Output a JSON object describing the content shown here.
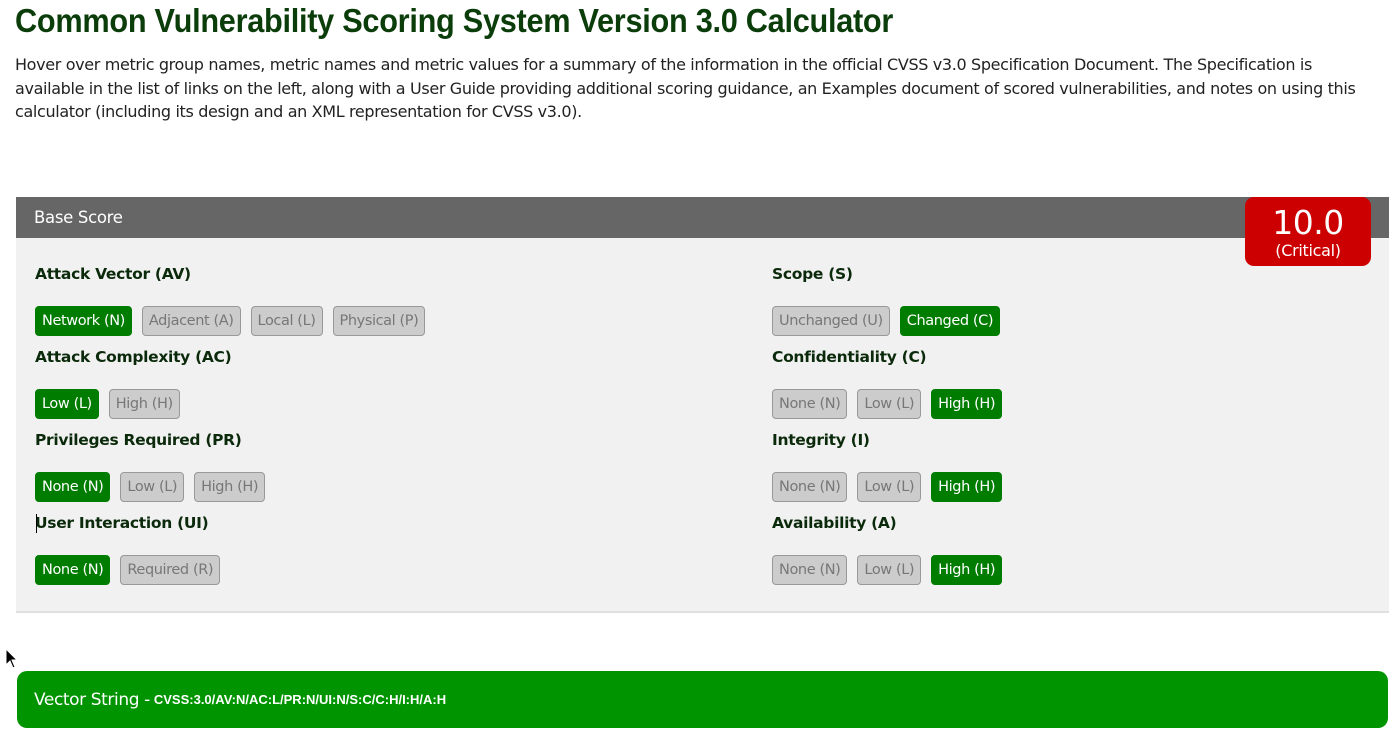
{
  "page": {
    "title": "Common Vulnerability Scoring System Version 3.0 Calculator",
    "intro": "Hover over metric group names, metric names and metric values for a summary of the information in the official CVSS v3.0 Specification Document. The Specification is available in the list of links on the left, along with a User Guide providing additional scoring guidance, an Examples document of scored vulnerabilities, and notes on using this calculator (including its design and an XML representation for CVSS v3.0)."
  },
  "base": {
    "header": "Base Score",
    "score": "10.0",
    "severity": "(Critical)",
    "severity_color": "#cc0000"
  },
  "metrics": [
    {
      "label": "Attack Vector (AV)",
      "options": [
        "Network (N)",
        "Adjacent (A)",
        "Local (L)",
        "Physical (P)"
      ],
      "selected": 0
    },
    {
      "label": "Attack Complexity (AC)",
      "options": [
        "Low (L)",
        "High (H)"
      ],
      "selected": 0
    },
    {
      "label": "Privileges Required (PR)",
      "options": [
        "None (N)",
        "Low (L)",
        "High (H)"
      ],
      "selected": 0
    },
    {
      "label": "User Interaction (UI)",
      "options": [
        "None (N)",
        "Required (R)"
      ],
      "selected": 0
    },
    {
      "label": "Scope (S)",
      "options": [
        "Unchanged (U)",
        "Changed (C)"
      ],
      "selected": 1
    },
    {
      "label": "Confidentiality (C)",
      "options": [
        "None (N)",
        "Low (L)",
        "High (H)"
      ],
      "selected": 2
    },
    {
      "label": "Integrity (I)",
      "options": [
        "None (N)",
        "Low (L)",
        "High (H)"
      ],
      "selected": 2
    },
    {
      "label": "Availability (A)",
      "options": [
        "None (N)",
        "Low (L)",
        "High (H)"
      ],
      "selected": 2
    }
  ],
  "vector": {
    "label": "Vector String - ",
    "value": "CVSS:3.0/AV:N/AC:L/PR:N/UI:N/S:C/C:H/I:H/A:H"
  },
  "colors": {
    "selected": "#007c00",
    "vector_bar": "#009400",
    "header_bar": "#666666"
  }
}
